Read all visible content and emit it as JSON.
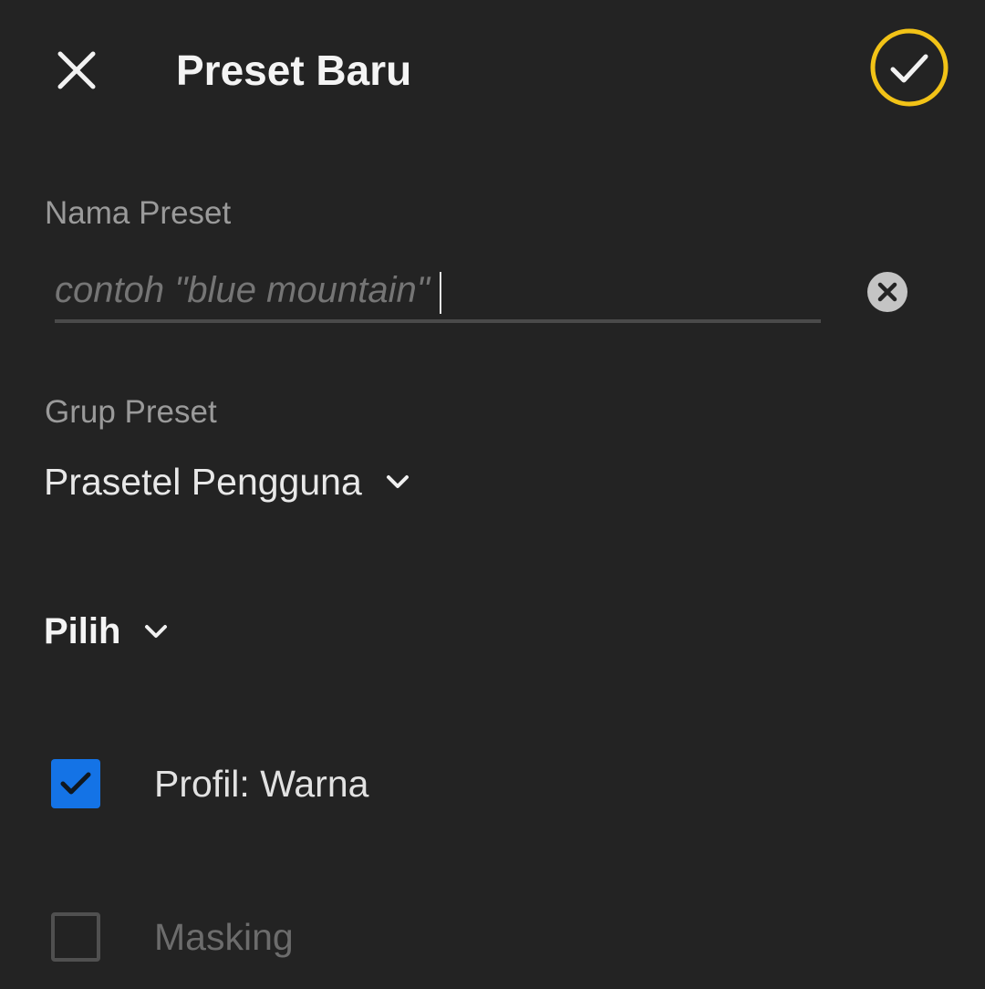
{
  "header": {
    "title": "Preset Baru",
    "close_icon": "close-icon",
    "confirm_icon": "checkmark-icon",
    "confirm_ring_color": "#f2c317"
  },
  "name_field": {
    "label": "Nama Preset",
    "placeholder": "contoh \"blue mountain\"",
    "value": "",
    "clear_icon": "clear-circle-icon"
  },
  "group_field": {
    "label": "Grup Preset",
    "value": "Prasetel Pengguna",
    "icon": "chevron-down-icon"
  },
  "select_section": {
    "label": "Pilih",
    "icon": "chevron-down-icon"
  },
  "options": [
    {
      "label": "Profil: Warna",
      "checked": true
    },
    {
      "label": "Masking",
      "checked": false
    }
  ],
  "colors": {
    "background": "#232323",
    "accent_blue": "#1473e6",
    "highlight_yellow": "#f2c317"
  }
}
